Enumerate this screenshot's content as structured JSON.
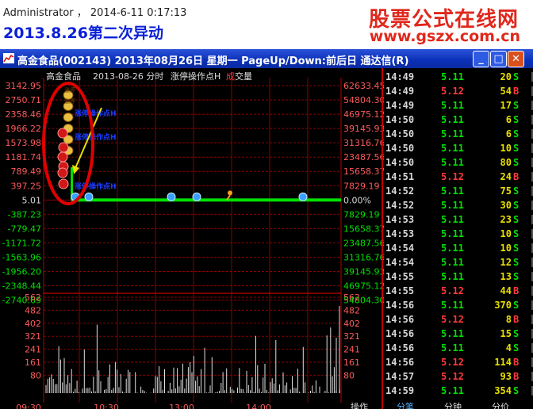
{
  "header": {
    "user_line": "Administrator  ，  2014-6-11 0:17:13",
    "title": "2013.8.26第二次异动",
    "brand_cn": "股票公式在线网",
    "brand_url": "www.gszx.com.cn"
  },
  "window": {
    "title": "高金食品(002143) 2013年08月26日 星期一 PageUp/Down:前后日 通达信(R)",
    "minimize": "_",
    "maximize": "□",
    "close": "✕"
  },
  "chart_info": {
    "stock_name": "高金食品",
    "date_label": "2013-08-26 分时",
    "indicator": "涨停操作点H",
    "cheng": "成",
    "vol_label": "交量"
  },
  "colors": {
    "up": "#ff3a3a",
    "down": "#00e000",
    "flat": "#e8e000",
    "price_label": "#ff5a5a",
    "grid": "#8b0000",
    "annotation": "#1a3cff",
    "guide_line": "#00e000",
    "circle": "#e00000"
  },
  "chart_data": {
    "type": "line",
    "price_axis": [
      "3142.95",
      "2750.71",
      "2358.46",
      "1966.22",
      "1573.98",
      "1181.74",
      "789.49",
      "397.25",
      "5.01",
      "-387.23",
      "-779.47",
      "-1171.72",
      "-1563.96",
      "-1956.20",
      "-2348.44",
      "-2740.69"
    ],
    "pct_axis": [
      "62633.45",
      "54804.30",
      "46975.12",
      "39145.93",
      "31316.76",
      "23487.56",
      "15658.37",
      "7829.19",
      "0.00%",
      "7829.19",
      "15658.37",
      "23487.56",
      "31316.76",
      "39145.93",
      "46975.12",
      "54804.30"
    ],
    "volume_axis": [
      "562",
      "482",
      "402",
      "321",
      "241",
      "161",
      "80"
    ],
    "time_ticks": [
      "09:30",
      "10:30",
      "13:00",
      "14:00"
    ],
    "annotations": [
      {
        "label": "涨停操作点H",
        "price": 2150
      },
      {
        "label": "涨停操作点H",
        "price": 1480
      },
      {
        "label": "涨停操作点H",
        "price": 5
      }
    ],
    "markers_top_labels": [
      "涨停",
      "涨停"
    ]
  },
  "ticks": [
    {
      "time": "14:49",
      "price": "5.11",
      "vol": "20",
      "flag": "S",
      "side": "down"
    },
    {
      "time": "14:49",
      "price": "5.12",
      "vol": "54",
      "flag": "B",
      "side": "up"
    },
    {
      "time": "14:49",
      "price": "5.11",
      "vol": "17",
      "flag": "S",
      "side": "down"
    },
    {
      "time": "14:50",
      "price": "5.11",
      "vol": "6",
      "flag": "S",
      "side": "down"
    },
    {
      "time": "14:50",
      "price": "5.11",
      "vol": "6",
      "flag": "S",
      "side": "down"
    },
    {
      "time": "14:50",
      "price": "5.11",
      "vol": "10",
      "flag": "S",
      "side": "down"
    },
    {
      "time": "14:50",
      "price": "5.11",
      "vol": "80",
      "flag": "S",
      "side": "down"
    },
    {
      "time": "14:51",
      "price": "5.12",
      "vol": "24",
      "flag": "B",
      "side": "up"
    },
    {
      "time": "14:52",
      "price": "5.11",
      "vol": "75",
      "flag": "S",
      "side": "down"
    },
    {
      "time": "14:52",
      "price": "5.11",
      "vol": "30",
      "flag": "S",
      "side": "down"
    },
    {
      "time": "14:53",
      "price": "5.11",
      "vol": "23",
      "flag": "S",
      "side": "down"
    },
    {
      "time": "14:53",
      "price": "5.11",
      "vol": "10",
      "flag": "S",
      "side": "down"
    },
    {
      "time": "14:54",
      "price": "5.11",
      "vol": "10",
      "flag": "S",
      "side": "down"
    },
    {
      "time": "14:54",
      "price": "5.11",
      "vol": "12",
      "flag": "S",
      "side": "down"
    },
    {
      "time": "14:55",
      "price": "5.11",
      "vol": "13",
      "flag": "S",
      "side": "down"
    },
    {
      "time": "14:55",
      "price": "5.12",
      "vol": "44",
      "flag": "B",
      "side": "up"
    },
    {
      "time": "14:56",
      "price": "5.11",
      "vol": "370",
      "flag": "S",
      "side": "down"
    },
    {
      "time": "14:56",
      "price": "5.12",
      "vol": "8",
      "flag": "B",
      "side": "up"
    },
    {
      "time": "14:56",
      "price": "5.11",
      "vol": "15",
      "flag": "S",
      "side": "down"
    },
    {
      "time": "14:56",
      "price": "5.11",
      "vol": "4",
      "flag": "S",
      "side": "down"
    },
    {
      "time": "14:56",
      "price": "5.12",
      "vol": "114",
      "flag": "B",
      "side": "up"
    },
    {
      "time": "14:57",
      "price": "5.12",
      "vol": "93",
      "flag": "B",
      "side": "up"
    },
    {
      "time": "14:59",
      "price": "5.11",
      "vol": "354",
      "flag": "S",
      "side": "down"
    }
  ],
  "tabs": [
    "操作",
    "分笔",
    "分钟",
    "分价"
  ]
}
